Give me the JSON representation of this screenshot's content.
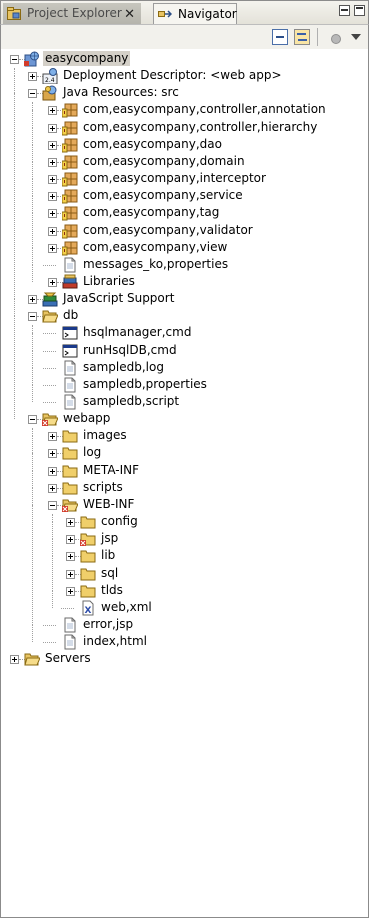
{
  "tabs": [
    {
      "label": "Project Explorer",
      "icon": "project-explorer-icon",
      "active": true
    },
    {
      "label": "Navigator",
      "icon": "navigator-icon",
      "active": false
    }
  ],
  "toolbar": {
    "buttons": [
      "collapse-all-icon",
      "link-with-editor-icon",
      "view-settings-icon",
      "view-menu-icon"
    ]
  },
  "tree": [
    {
      "label": "easycompany",
      "level": 0,
      "icon": "web-project",
      "tw": "minus",
      "selected": true
    },
    {
      "label": "Deployment Descriptor: <web app>",
      "level": 1,
      "icon": "deploy-descriptor",
      "tw": "plus"
    },
    {
      "label": "Java Resources: src",
      "level": 1,
      "icon": "java-resources",
      "tw": "minus"
    },
    {
      "label": "com,easycompany,controller,annotation",
      "level": 2,
      "icon": "package",
      "tw": "plus"
    },
    {
      "label": "com,easycompany,controller,hierarchy",
      "level": 2,
      "icon": "package",
      "tw": "plus"
    },
    {
      "label": "com,easycompany,dao",
      "level": 2,
      "icon": "package",
      "tw": "plus"
    },
    {
      "label": "com,easycompany,domain",
      "level": 2,
      "icon": "package",
      "tw": "plus"
    },
    {
      "label": "com,easycompany,interceptor",
      "level": 2,
      "icon": "package",
      "tw": "plus"
    },
    {
      "label": "com,easycompany,service",
      "level": 2,
      "icon": "package",
      "tw": "plus"
    },
    {
      "label": "com,easycompany,tag",
      "level": 2,
      "icon": "package",
      "tw": "plus"
    },
    {
      "label": "com,easycompany,validator",
      "level": 2,
      "icon": "package",
      "tw": "plus"
    },
    {
      "label": "com,easycompany,view",
      "level": 2,
      "icon": "package",
      "tw": "plus"
    },
    {
      "label": "messages_ko,properties",
      "level": 2,
      "icon": "file",
      "tw": null
    },
    {
      "label": "Libraries",
      "level": 2,
      "icon": "libraries",
      "tw": "plus"
    },
    {
      "label": "JavaScript Support",
      "level": 1,
      "icon": "javascript-support",
      "tw": "plus"
    },
    {
      "label": "db",
      "level": 1,
      "icon": "folder-open",
      "tw": "minus"
    },
    {
      "label": "hsqlmanager,cmd",
      "level": 2,
      "icon": "cmd",
      "tw": null
    },
    {
      "label": "runHsqlDB,cmd",
      "level": 2,
      "icon": "cmd",
      "tw": null
    },
    {
      "label": "sampledb,log",
      "level": 2,
      "icon": "file",
      "tw": null
    },
    {
      "label": "sampledb,properties",
      "level": 2,
      "icon": "file",
      "tw": null
    },
    {
      "label": "sampledb,script",
      "level": 2,
      "icon": "file",
      "tw": null
    },
    {
      "label": "webapp",
      "level": 1,
      "icon": "folder-open-error",
      "tw": "minus"
    },
    {
      "label": "images",
      "level": 2,
      "icon": "folder",
      "tw": "plus"
    },
    {
      "label": "log",
      "level": 2,
      "icon": "folder",
      "tw": "plus"
    },
    {
      "label": "META-INF",
      "level": 2,
      "icon": "folder",
      "tw": "plus"
    },
    {
      "label": "scripts",
      "level": 2,
      "icon": "folder",
      "tw": "plus"
    },
    {
      "label": "WEB-INF",
      "level": 2,
      "icon": "folder-open-error",
      "tw": "minus"
    },
    {
      "label": "config",
      "level": 3,
      "icon": "folder",
      "tw": "plus"
    },
    {
      "label": "jsp",
      "level": 3,
      "icon": "folder-error",
      "tw": "plus"
    },
    {
      "label": "lib",
      "level": 3,
      "icon": "folder",
      "tw": "plus"
    },
    {
      "label": "sql",
      "level": 3,
      "icon": "folder",
      "tw": "plus"
    },
    {
      "label": "tlds",
      "level": 3,
      "icon": "folder",
      "tw": "plus"
    },
    {
      "label": "web,xml",
      "level": 3,
      "icon": "xml",
      "tw": null
    },
    {
      "label": "error,jsp",
      "level": 2,
      "icon": "file",
      "tw": null
    },
    {
      "label": "index,html",
      "level": 2,
      "icon": "file",
      "tw": null
    },
    {
      "label": "Servers",
      "level": 0,
      "icon": "folder-open",
      "tw": "plus"
    }
  ]
}
